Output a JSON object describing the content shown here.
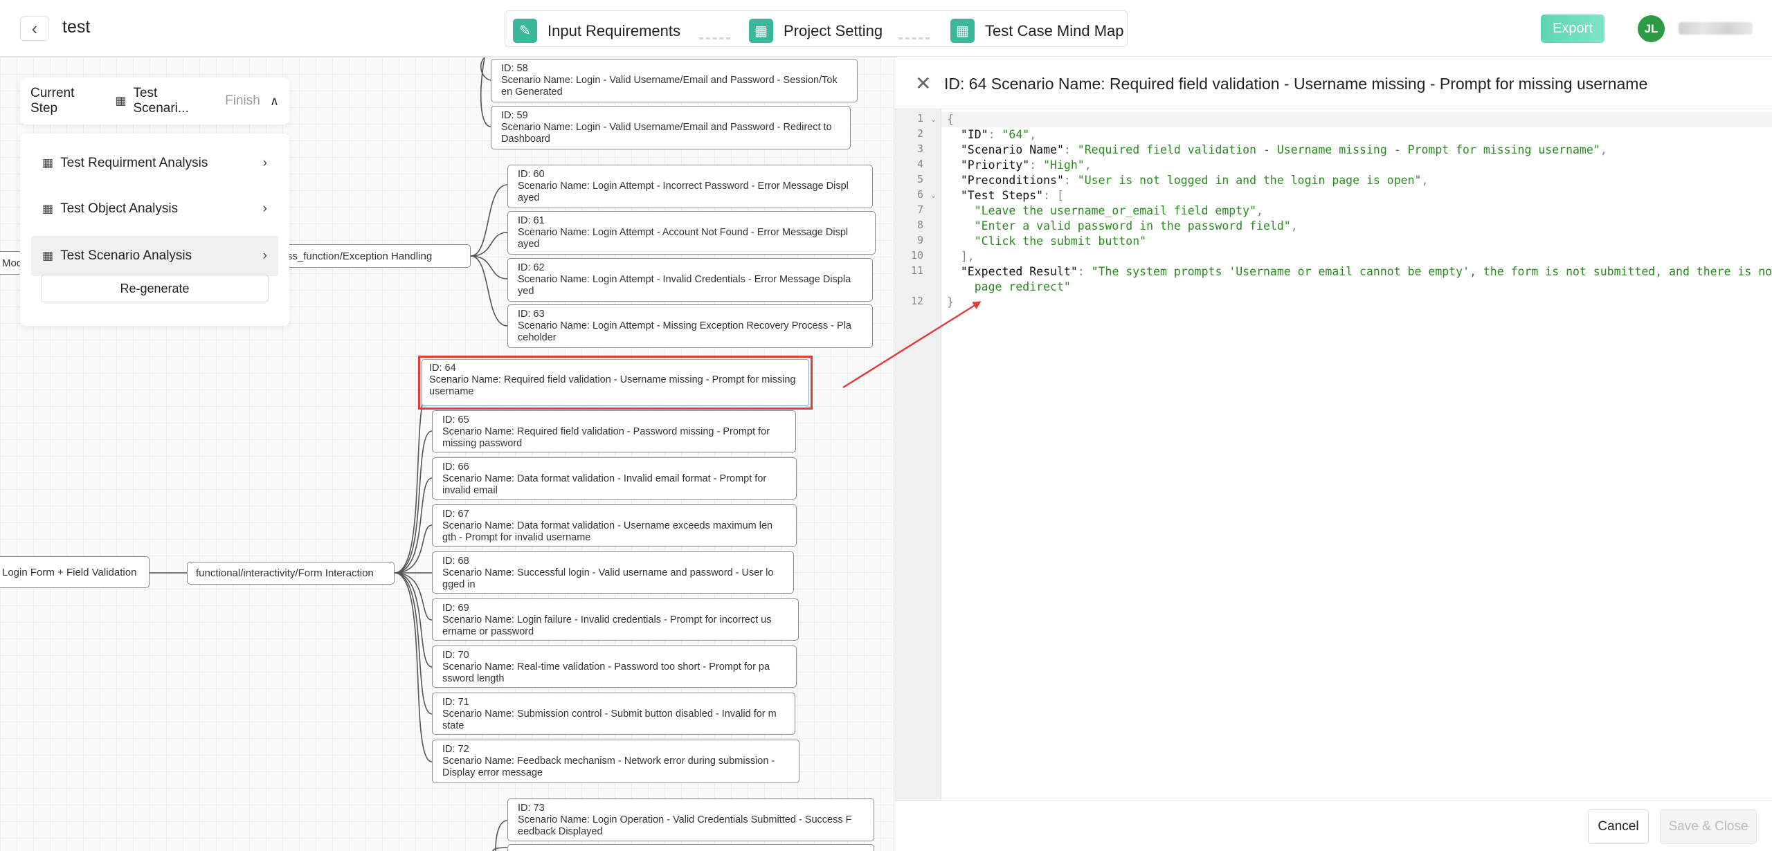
{
  "header": {
    "project_name": "test",
    "steps": [
      {
        "label": "Input Requirements",
        "icon": "edit-icon"
      },
      {
        "label": "Project Setting",
        "icon": "grid-icon"
      },
      {
        "label": "Test Case Mind Map",
        "icon": "grid-icon"
      }
    ],
    "export_label": "Export",
    "avatar_initials": "JL",
    "accent_color": "#3bb89b"
  },
  "step_panel": {
    "current_label": "Current Step",
    "current_value": "Test Scenari...",
    "current_status": "Finish",
    "items": [
      {
        "label": "Test Requirment Analysis"
      },
      {
        "label": "Test Object Analysis"
      },
      {
        "label": "Test Scenario Analysis"
      }
    ],
    "regenerate_label": "Re-generate"
  },
  "mindmap": {
    "root_partial": "Modu",
    "left_node": "Login Form + Field Validation",
    "branch_exception": "Business_function/Exception Handling",
    "branch_form": "functional/interactivity/Form Interaction",
    "top_nodes": [
      {
        "id": "ID: 58",
        "name": "Scenario Name: Login - Valid Username/Email and Password - Session/Tok en Generated"
      },
      {
        "id": "ID: 59",
        "name": "Scenario Name: Login - Valid Username/Email and Password - Redirect to Dashboard"
      }
    ],
    "exception_nodes": [
      {
        "id": "ID: 60",
        "name": "Scenario Name: Login Attempt - Incorrect Password - Error Message Displ ayed"
      },
      {
        "id": "ID: 61",
        "name": "Scenario Name: Login Attempt - Account Not Found - Error Message Displ ayed"
      },
      {
        "id": "ID: 62",
        "name": "Scenario Name: Login Attempt - Invalid Credentials - Error Message Displa yed"
      },
      {
        "id": "ID: 63",
        "name": "Scenario Name: Login Attempt - Missing Exception Recovery Process - Pla ceholder"
      }
    ],
    "form_nodes": [
      {
        "id": "ID: 64",
        "name": "Scenario Name: Required field validation - Username missing - Prompt for missing username"
      },
      {
        "id": "ID: 65",
        "name": "Scenario Name: Required field validation - Password missing - Prompt for missing password"
      },
      {
        "id": "ID: 66",
        "name": "Scenario Name: Data format validation - Invalid email format - Prompt for invalid email"
      },
      {
        "id": "ID: 67",
        "name": "Scenario Name: Data format validation - Username exceeds maximum len gth - Prompt for invalid username"
      },
      {
        "id": "ID: 68",
        "name": "Scenario Name: Successful login - Valid username and password - User lo gged in"
      },
      {
        "id": "ID: 69",
        "name": "Scenario Name: Login failure - Invalid credentials - Prompt for incorrect us ername or password"
      },
      {
        "id": "ID: 70",
        "name": "Scenario Name: Real-time validation - Password too short - Prompt for pa ssword length"
      },
      {
        "id": "ID: 71",
        "name": "Scenario Name: Submission control - Submit button disabled - Invalid for m state"
      },
      {
        "id": "ID: 72",
        "name": "Scenario Name: Feedback mechanism - Network error during submission - Display error message"
      }
    ],
    "bottom_nodes": [
      {
        "id": "ID: 73",
        "name": "Scenario Name: Login Operation - Valid Credentials Submitted - Success F eedback Displayed"
      }
    ],
    "highlight_color": "#e53935"
  },
  "detail": {
    "title": "ID: 64 Scenario Name: Required field validation - Username missing - Prompt for missing username",
    "line_numbers": [
      "1",
      "2",
      "3",
      "4",
      "5",
      "6",
      "7",
      "8",
      "9",
      "10",
      "11",
      "12"
    ],
    "code": {
      "open": "{",
      "id_key": "\"ID\"",
      "id_val": "\"64\"",
      "name_key": "\"Scenario Name\"",
      "name_val": "\"Required field validation - Username missing - Prompt for missing username\"",
      "prio_key": "\"Priority\"",
      "prio_val": "\"High\"",
      "pre_key": "\"Preconditions\"",
      "pre_val": "\"User is not logged in and the login page is open\"",
      "steps_key": "\"Test Steps\"",
      "step1": "\"Leave the username_or_email field empty\"",
      "step2": "\"Enter a valid password in the password field\"",
      "step3": "\"Click the submit button\"",
      "exp_key": "\"Expected Result\"",
      "exp_val_1": "\"The system prompts 'Username or email cannot be empty', the form is not submitted, and there is no",
      "exp_val_2": "page redirect\"",
      "close": "}"
    },
    "cancel_label": "Cancel",
    "save_label": "Save & Close"
  }
}
